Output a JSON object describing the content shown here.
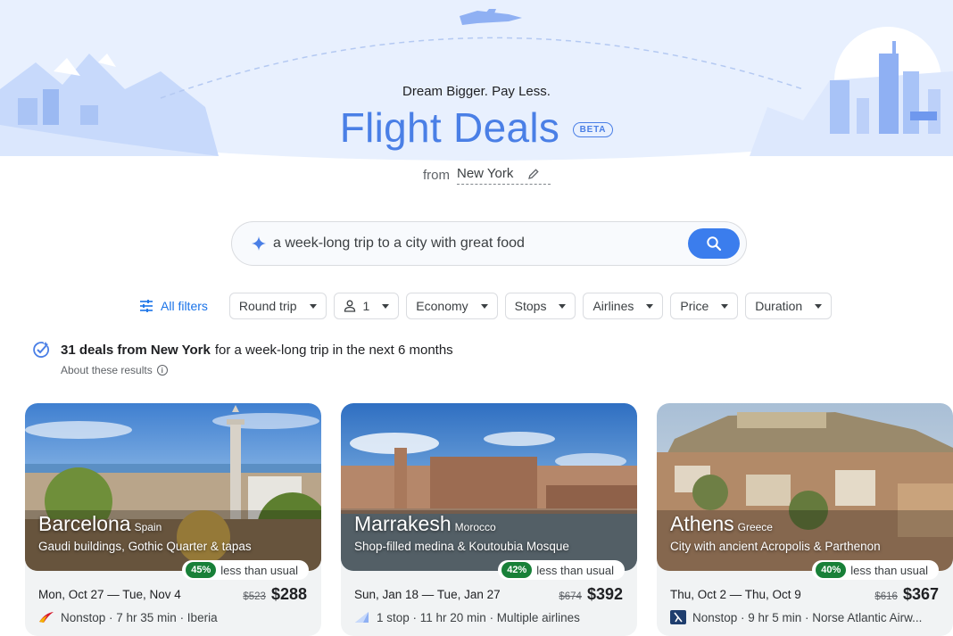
{
  "hero": {
    "tagline": "Dream Bigger. Pay Less.",
    "title": "Flight Deals",
    "badge": "BETA",
    "from_label": "from",
    "from_city": "New York"
  },
  "search": {
    "query": "a week-long trip to a city with great food"
  },
  "filters": {
    "all_filters": "All filters",
    "round_trip": "Round trip",
    "passengers": "1",
    "cabin": "Economy",
    "stops": "Stops",
    "airlines": "Airlines",
    "price": "Price",
    "duration": "Duration"
  },
  "summary": {
    "bold": "31 deals from New York",
    "rest": "for a week-long trip in the next 6 months",
    "about": "About these results"
  },
  "cards": [
    {
      "city": "Barcelona",
      "country": "Spain",
      "description": "Gaudi buildings, Gothic Quarter & tapas",
      "percent": "45%",
      "usual": "less than usual",
      "dates": "Mon, Oct 27 — Tue, Nov 4",
      "old_price": "$523",
      "price": "$288",
      "flight": "Nonstop · 7 hr 35 min · Iberia",
      "airline_logo": "iberia-logo-icon"
    },
    {
      "city": "Marrakesh",
      "country": "Morocco",
      "description": "Shop-filled medina & Koutoubia Mosque",
      "percent": "42%",
      "usual": "less than usual",
      "dates": "Sun, Jan 18 — Tue, Jan 27",
      "old_price": "$674",
      "price": "$392",
      "flight": "1 stop · 11 hr 20 min · Multiple airlines",
      "airline_logo": "multiple-airlines-icon"
    },
    {
      "city": "Athens",
      "country": "Greece",
      "description": "City with ancient Acropolis & Parthenon",
      "percent": "40%",
      "usual": "less than usual",
      "dates": "Thu, Oct 2 — Thu, Oct 9",
      "old_price": "$616",
      "price": "$367",
      "flight": "Nonstop · 9 hr 5 min · Norse Atlantic Airw...",
      "airline_logo": "norse-logo-icon"
    }
  ],
  "colors": {
    "accent": "#4a7fe6",
    "search_button": "#3b7ded",
    "discount_badge": "#188038"
  }
}
